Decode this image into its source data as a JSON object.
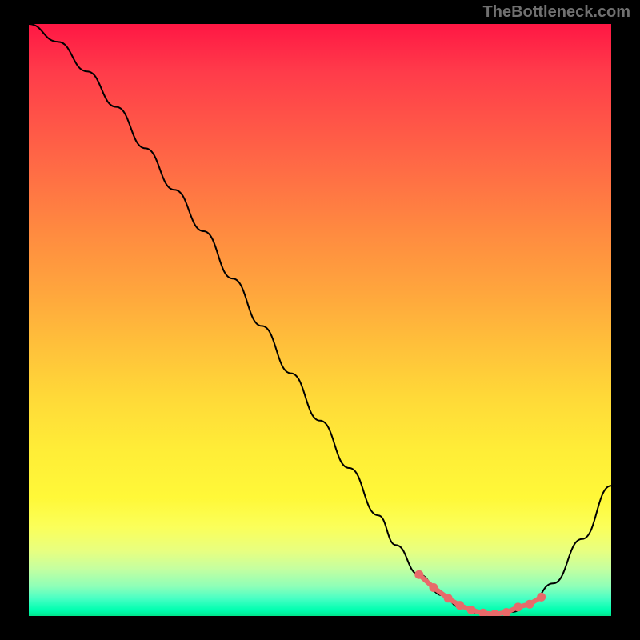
{
  "watermark": "TheBottleneck.com",
  "chart_data": {
    "type": "line",
    "title": "",
    "xlabel": "",
    "ylabel": "",
    "xlim": [
      0,
      100
    ],
    "ylim": [
      0,
      100
    ],
    "series": [
      {
        "name": "bottleneck-curve",
        "x": [
          0,
          5,
          10,
          15,
          20,
          25,
          30,
          35,
          40,
          45,
          50,
          55,
          60,
          63,
          67,
          71,
          74,
          77,
          80,
          83,
          86,
          90,
          95,
          100
        ],
        "y": [
          100,
          97,
          92,
          86,
          79,
          72,
          65,
          57,
          49,
          41,
          33,
          25,
          17,
          12,
          7,
          3.5,
          1.5,
          0.5,
          0.3,
          0.7,
          2,
          5.5,
          13,
          22
        ]
      }
    ],
    "markers": {
      "name": "band-markers",
      "x": [
        67,
        69.5,
        72,
        74,
        76,
        78,
        80,
        82,
        84,
        86,
        88
      ],
      "y": [
        7,
        4.8,
        3,
        1.8,
        1,
        0.5,
        0.3,
        0.6,
        1.5,
        2,
        3.2
      ]
    },
    "background_gradient": {
      "top": "#ff1744",
      "mid": "#ffed37",
      "bottom": "#00e58c"
    }
  }
}
